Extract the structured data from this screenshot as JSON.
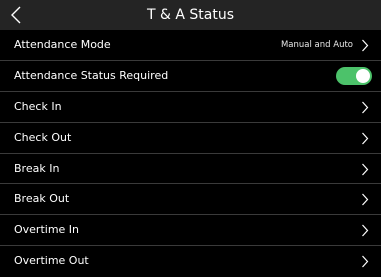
{
  "header": {
    "title": "T & A Status",
    "back_icon": "chevron-left-icon"
  },
  "colors": {
    "background": "#000000",
    "header_background": "#242424",
    "divider": "#3a3a3a",
    "toggle_on": "#4cc26a"
  },
  "settings": {
    "attendance_mode": {
      "label": "Attendance Mode",
      "value": "Manual and Auto"
    },
    "status_required": {
      "label": "Attendance Status Required",
      "enabled": true
    },
    "check_in": {
      "label": "Check In"
    },
    "check_out": {
      "label": "Check Out"
    },
    "break_in": {
      "label": "Break In"
    },
    "break_out": {
      "label": "Break Out"
    },
    "overtime_in": {
      "label": "Overtime In"
    },
    "overtime_out": {
      "label": "Overtime Out"
    }
  }
}
